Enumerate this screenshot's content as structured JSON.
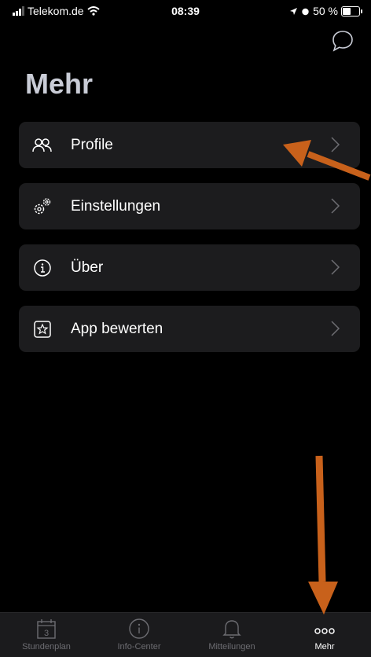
{
  "status": {
    "carrier": "Telekom.de",
    "time": "08:39",
    "battery_text": "50 %",
    "battery_level": 0.5
  },
  "header": {
    "title": "Mehr",
    "chat_icon": "chat-bubble-icon"
  },
  "menu": {
    "items": [
      {
        "label": "Profile",
        "icon": "profiles-icon"
      },
      {
        "label": "Einstellungen",
        "icon": "settings-gears-icon"
      },
      {
        "label": "Über",
        "icon": "info-icon"
      },
      {
        "label": "App bewerten",
        "icon": "rate-star-icon"
      }
    ]
  },
  "tabbar": {
    "tabs": [
      {
        "label": "Stundenplan",
        "icon": "calendar-icon",
        "badge": "3"
      },
      {
        "label": "Info-Center",
        "icon": "info-icon"
      },
      {
        "label": "Mitteilungen",
        "icon": "bell-icon"
      },
      {
        "label": "Mehr",
        "icon": "more-dots-icon",
        "active": true
      }
    ]
  },
  "colors": {
    "background": "#000000",
    "card": "#1c1c1e",
    "title": "#c9ccd6",
    "annotation_arrow": "#c8611b",
    "tab_inactive": "#6d6d72"
  }
}
